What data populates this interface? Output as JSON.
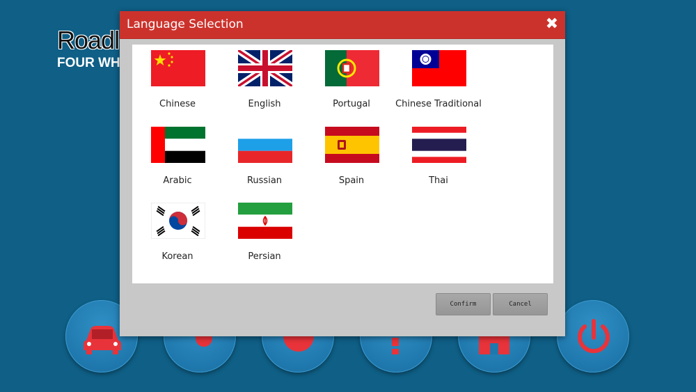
{
  "app": {
    "brand_title": "Roadl",
    "brand_subtitle": "FOUR WHE"
  },
  "dock": [
    {
      "icon": "car-icon"
    },
    {
      "icon": "wrench-gear-icon"
    },
    {
      "icon": "globe-icon"
    },
    {
      "icon": "question-icon"
    },
    {
      "icon": "home-icon"
    },
    {
      "icon": "power-icon"
    }
  ],
  "dialog": {
    "title": "Language Selection",
    "close_glyph": "✖",
    "confirm_label": "Confirm",
    "cancel_label": "Cancel"
  },
  "languages": [
    {
      "label": "Chinese",
      "flag": "china-flag-icon"
    },
    {
      "label": "English",
      "flag": "uk-flag-icon"
    },
    {
      "label": "Portugal",
      "flag": "portugal-flag-icon"
    },
    {
      "label": "Chinese Traditional",
      "flag": "taiwan-flag-icon"
    },
    {
      "label": "Arabic",
      "flag": "uae-flag-icon"
    },
    {
      "label": "Russian",
      "flag": "russia-flag-icon"
    },
    {
      "label": "Spain",
      "flag": "spain-flag-icon"
    },
    {
      "label": "Thai",
      "flag": "thailand-flag-icon"
    },
    {
      "label": "Korean",
      "flag": "korea-flag-icon"
    },
    {
      "label": "Persian",
      "flag": "iran-flag-icon"
    }
  ],
  "colors": {
    "background": "#0f5f86",
    "dialog_header": "#cc322c",
    "dock_icon": "#e8333a"
  }
}
